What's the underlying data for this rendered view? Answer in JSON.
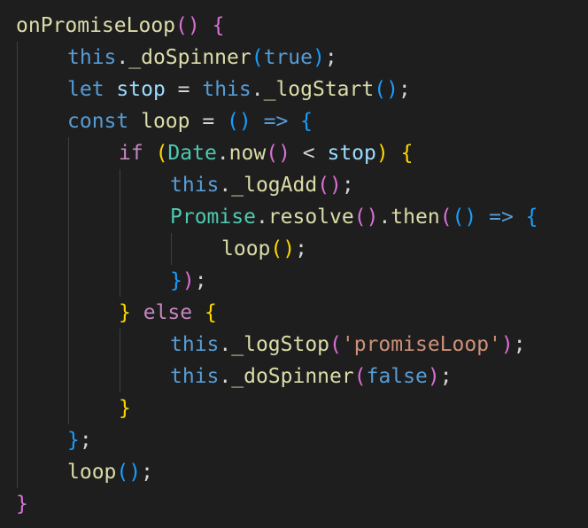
{
  "colors": {
    "background": "#1e1e1e",
    "function": "#dcdcaa",
    "keyword": "#569cd6",
    "control": "#c586c0",
    "variable": "#9cdcfe",
    "class": "#4ec9b0",
    "string": "#ce9178",
    "punctuation": "#d4d4d4",
    "bracket_gold": "#ffd700",
    "bracket_pink": "#da70d6",
    "bracket_blue": "#179fff",
    "indent_guide": "#404040",
    "indent_guide_active": "#707070"
  },
  "code": {
    "lines": [
      {
        "indent": 0,
        "tokens": [
          {
            "t": "onPromiseLoop",
            "c": "function"
          },
          {
            "t": "()",
            "c": "bracket_pink"
          },
          {
            "t": " ",
            "c": "punctuation"
          },
          {
            "t": "{",
            "c": "bracket_pink"
          }
        ]
      },
      {
        "indent": 1,
        "tokens": [
          {
            "t": "this",
            "c": "keyword"
          },
          {
            "t": ".",
            "c": "punctuation"
          },
          {
            "t": "_doSpinner",
            "c": "function"
          },
          {
            "t": "(",
            "c": "bracket_blue"
          },
          {
            "t": "true",
            "c": "keyword"
          },
          {
            "t": ")",
            "c": "bracket_blue"
          },
          {
            "t": ";",
            "c": "punctuation"
          }
        ]
      },
      {
        "indent": 1,
        "tokens": [
          {
            "t": "let",
            "c": "keyword"
          },
          {
            "t": " ",
            "c": "punctuation"
          },
          {
            "t": "stop",
            "c": "variable"
          },
          {
            "t": " = ",
            "c": "punctuation"
          },
          {
            "t": "this",
            "c": "keyword"
          },
          {
            "t": ".",
            "c": "punctuation"
          },
          {
            "t": "_logStart",
            "c": "function"
          },
          {
            "t": "()",
            "c": "bracket_blue"
          },
          {
            "t": ";",
            "c": "punctuation"
          }
        ]
      },
      {
        "indent": 1,
        "tokens": [
          {
            "t": "const",
            "c": "keyword"
          },
          {
            "t": " ",
            "c": "punctuation"
          },
          {
            "t": "loop",
            "c": "function"
          },
          {
            "t": " = ",
            "c": "punctuation"
          },
          {
            "t": "()",
            "c": "bracket_blue"
          },
          {
            "t": " ",
            "c": "punctuation"
          },
          {
            "t": "=>",
            "c": "keyword"
          },
          {
            "t": " ",
            "c": "punctuation"
          },
          {
            "t": "{",
            "c": "bracket_blue"
          }
        ]
      },
      {
        "indent": 2,
        "tokens": [
          {
            "t": "if",
            "c": "control"
          },
          {
            "t": " ",
            "c": "punctuation"
          },
          {
            "t": "(",
            "c": "bracket_gold"
          },
          {
            "t": "Date",
            "c": "class"
          },
          {
            "t": ".",
            "c": "punctuation"
          },
          {
            "t": "now",
            "c": "function"
          },
          {
            "t": "()",
            "c": "bracket_pink"
          },
          {
            "t": " < ",
            "c": "punctuation"
          },
          {
            "t": "stop",
            "c": "variable"
          },
          {
            "t": ")",
            "c": "bracket_gold"
          },
          {
            "t": " ",
            "c": "punctuation"
          },
          {
            "t": "{",
            "c": "bracket_gold"
          }
        ]
      },
      {
        "indent": 3,
        "tokens": [
          {
            "t": "this",
            "c": "keyword"
          },
          {
            "t": ".",
            "c": "punctuation"
          },
          {
            "t": "_logAdd",
            "c": "function"
          },
          {
            "t": "()",
            "c": "bracket_pink"
          },
          {
            "t": ";",
            "c": "punctuation"
          }
        ]
      },
      {
        "indent": 3,
        "tokens": [
          {
            "t": "Promise",
            "c": "class"
          },
          {
            "t": ".",
            "c": "punctuation"
          },
          {
            "t": "resolve",
            "c": "function"
          },
          {
            "t": "()",
            "c": "bracket_pink"
          },
          {
            "t": ".",
            "c": "punctuation"
          },
          {
            "t": "then",
            "c": "function"
          },
          {
            "t": "(",
            "c": "bracket_pink"
          },
          {
            "t": "()",
            "c": "bracket_blue"
          },
          {
            "t": " ",
            "c": "punctuation"
          },
          {
            "t": "=>",
            "c": "keyword"
          },
          {
            "t": " ",
            "c": "punctuation"
          },
          {
            "t": "{",
            "c": "bracket_blue"
          }
        ]
      },
      {
        "indent": 4,
        "tokens": [
          {
            "t": "loop",
            "c": "function"
          },
          {
            "t": "()",
            "c": "bracket_gold"
          },
          {
            "t": ";",
            "c": "punctuation"
          }
        ]
      },
      {
        "indent": 3,
        "tokens": [
          {
            "t": "}",
            "c": "bracket_blue"
          },
          {
            "t": ")",
            "c": "bracket_pink"
          },
          {
            "t": ";",
            "c": "punctuation"
          }
        ]
      },
      {
        "indent": 2,
        "tokens": [
          {
            "t": "}",
            "c": "bracket_gold"
          },
          {
            "t": " ",
            "c": "punctuation"
          },
          {
            "t": "else",
            "c": "control"
          },
          {
            "t": " ",
            "c": "punctuation"
          },
          {
            "t": "{",
            "c": "bracket_gold"
          }
        ]
      },
      {
        "indent": 3,
        "tokens": [
          {
            "t": "this",
            "c": "keyword"
          },
          {
            "t": ".",
            "c": "punctuation"
          },
          {
            "t": "_logStop",
            "c": "function"
          },
          {
            "t": "(",
            "c": "bracket_pink"
          },
          {
            "t": "'promiseLoop'",
            "c": "string"
          },
          {
            "t": ")",
            "c": "bracket_pink"
          },
          {
            "t": ";",
            "c": "punctuation"
          }
        ]
      },
      {
        "indent": 3,
        "tokens": [
          {
            "t": "this",
            "c": "keyword"
          },
          {
            "t": ".",
            "c": "punctuation"
          },
          {
            "t": "_doSpinner",
            "c": "function"
          },
          {
            "t": "(",
            "c": "bracket_pink"
          },
          {
            "t": "false",
            "c": "keyword"
          },
          {
            "t": ")",
            "c": "bracket_pink"
          },
          {
            "t": ";",
            "c": "punctuation"
          }
        ]
      },
      {
        "indent": 2,
        "tokens": [
          {
            "t": "}",
            "c": "bracket_gold"
          }
        ]
      },
      {
        "indent": 1,
        "tokens": [
          {
            "t": "}",
            "c": "bracket_blue"
          },
          {
            "t": ";",
            "c": "punctuation"
          }
        ]
      },
      {
        "indent": 1,
        "tokens": [
          {
            "t": "loop",
            "c": "function"
          },
          {
            "t": "()",
            "c": "bracket_blue"
          },
          {
            "t": ";",
            "c": "punctuation"
          }
        ]
      },
      {
        "indent": 0,
        "tokens": [
          {
            "t": "}",
            "c": "bracket_pink"
          }
        ]
      }
    ]
  }
}
